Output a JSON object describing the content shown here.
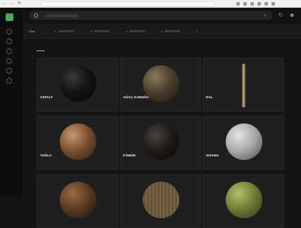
{
  "browser": {
    "back_icon": "arrow-left-icon",
    "forward_icon": "arrow-right-icon",
    "reload_icon": "reload-icon"
  },
  "sidebar": {
    "logo_color": "#3fae5a",
    "icons": [
      "home-icon",
      "grid-icon",
      "layers-icon",
      "box-icon",
      "image-icon",
      "settings-icon"
    ]
  },
  "search": {
    "icon": "search-icon",
    "clear_icon": "close-icon"
  },
  "toolbar_icons": [
    "refresh-icon",
    "user-icon"
  ],
  "filters": {
    "first_label": "Tümü",
    "chips": [
      "chip-1",
      "chip-2",
      "chip-3",
      "chip-4"
    ]
  },
  "materials": [
    {
      "name": "ASFALT",
      "color": "#0f0f0f"
    },
    {
      "name": "AĞAÇ KABUĞU",
      "color": "#4a3c2a"
    },
    {
      "name": "DAL",
      "color": "#8b7a5a"
    },
    {
      "name": "TUĞLA",
      "color": "#7a4e30"
    },
    {
      "name": "KÖMÜR",
      "color": "#1e1a16"
    },
    {
      "name": "SIVAMA",
      "color": "#a8a8a8"
    },
    {
      "name": "",
      "color": "#5a3a22"
    },
    {
      "name": "",
      "color": "#6b5a3d"
    },
    {
      "name": "",
      "color": "#6f7a35"
    }
  ]
}
